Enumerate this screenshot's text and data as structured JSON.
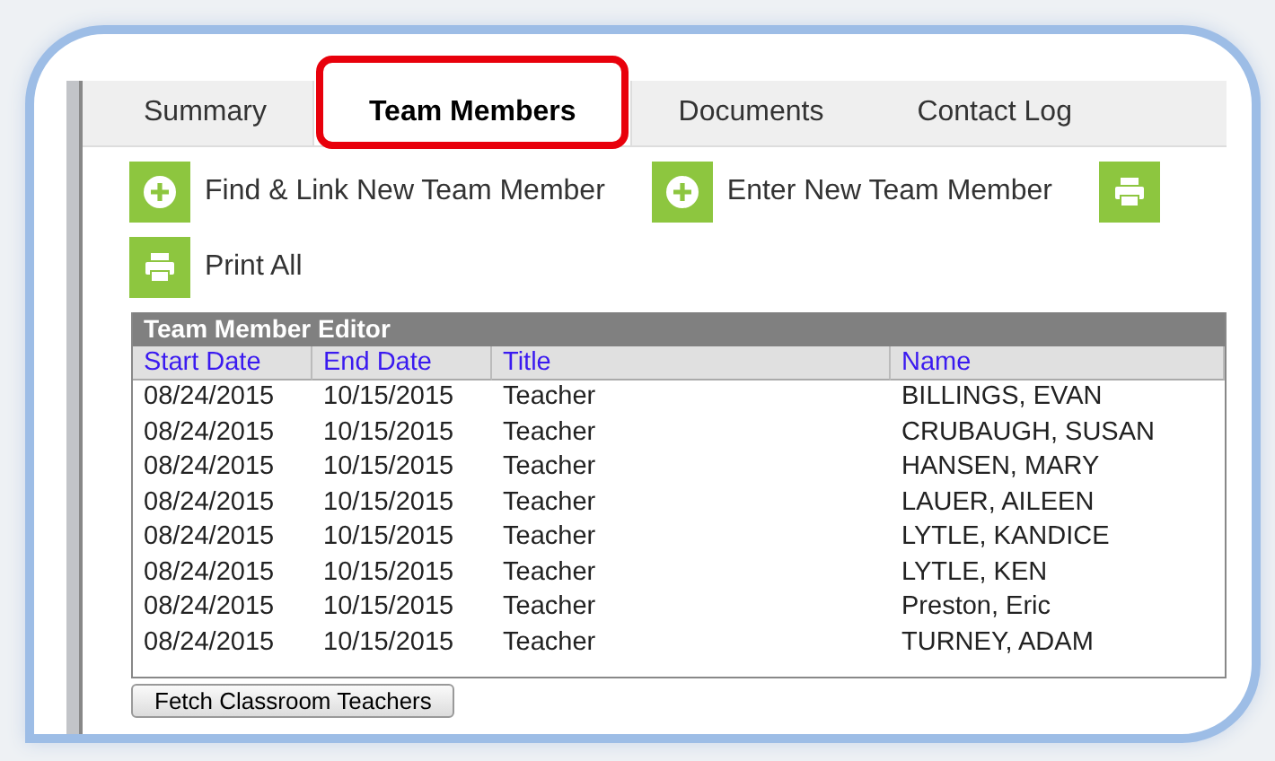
{
  "tabs": [
    {
      "label": "Summary",
      "selected": false
    },
    {
      "label": "Team Members",
      "selected": true
    },
    {
      "label": "Documents",
      "selected": false
    },
    {
      "label": "Contact Log",
      "selected": false
    }
  ],
  "actions": [
    {
      "label": "Find & Link New Team Member",
      "kind": "add"
    },
    {
      "label": "Enter New Team Member",
      "kind": "add"
    },
    {
      "kind": "print"
    },
    {
      "label": "Print All",
      "kind": "print"
    }
  ],
  "table": {
    "title": "Team Member Editor",
    "columns": [
      "Start Date",
      "End Date",
      "Title",
      "Name"
    ],
    "rows": [
      [
        "08/24/2015",
        "10/15/2015",
        "Teacher",
        "BILLINGS, EVAN"
      ],
      [
        "08/24/2015",
        "10/15/2015",
        "Teacher",
        "CRUBAUGH, SUSAN"
      ],
      [
        "08/24/2015",
        "10/15/2015",
        "Teacher",
        "HANSEN, MARY"
      ],
      [
        "08/24/2015",
        "10/15/2015",
        "Teacher",
        "LAUER, AILEEN"
      ],
      [
        "08/24/2015",
        "10/15/2015",
        "Teacher",
        "LYTLE, KANDICE"
      ],
      [
        "08/24/2015",
        "10/15/2015",
        "Teacher",
        "LYTLE, KEN"
      ],
      [
        "08/24/2015",
        "10/15/2015",
        "Teacher",
        "Preston, Eric"
      ],
      [
        "08/24/2015",
        "10/15/2015",
        "Teacher",
        "TURNEY, ADAM"
      ]
    ]
  },
  "button": "Fetch Classroom Teachers"
}
